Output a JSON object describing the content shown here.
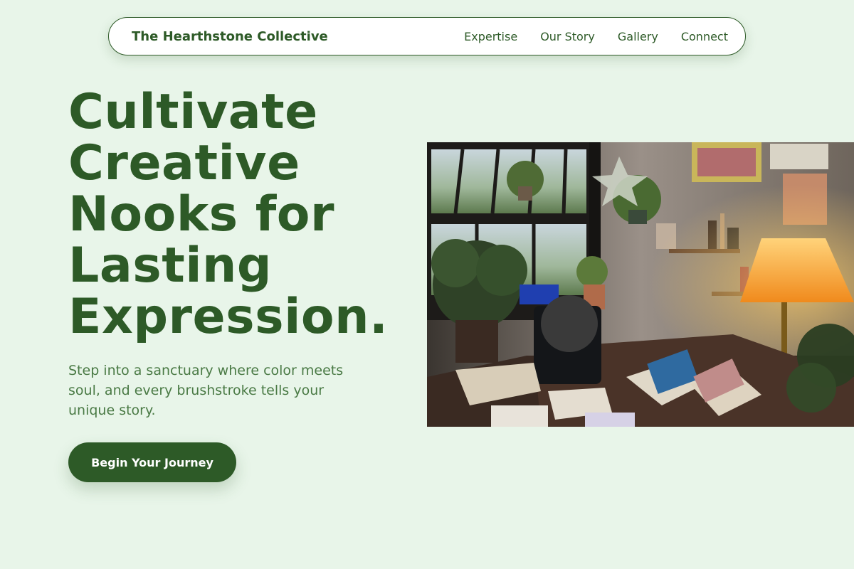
{
  "nav": {
    "brand": "The Hearthstone Collective",
    "links": [
      "Expertise",
      "Our Story",
      "Gallery",
      "Connect"
    ]
  },
  "hero": {
    "title_lines": [
      "Cultivate",
      "Creative",
      "Nooks for",
      "Lasting",
      "Expression."
    ],
    "subtitle": "Step into a sanctuary where color meets soul, and every brushstroke tells your unique story.",
    "cta_label": "Begin Your Journey"
  },
  "image": {
    "subject": "cozy art studio with plants, window, lamp and sketchbooks on a desk"
  },
  "colors": {
    "background": "#e8f5e9",
    "primary": "#2d5a27",
    "muted_text": "#4a7a45",
    "surface": "#ffffff"
  }
}
